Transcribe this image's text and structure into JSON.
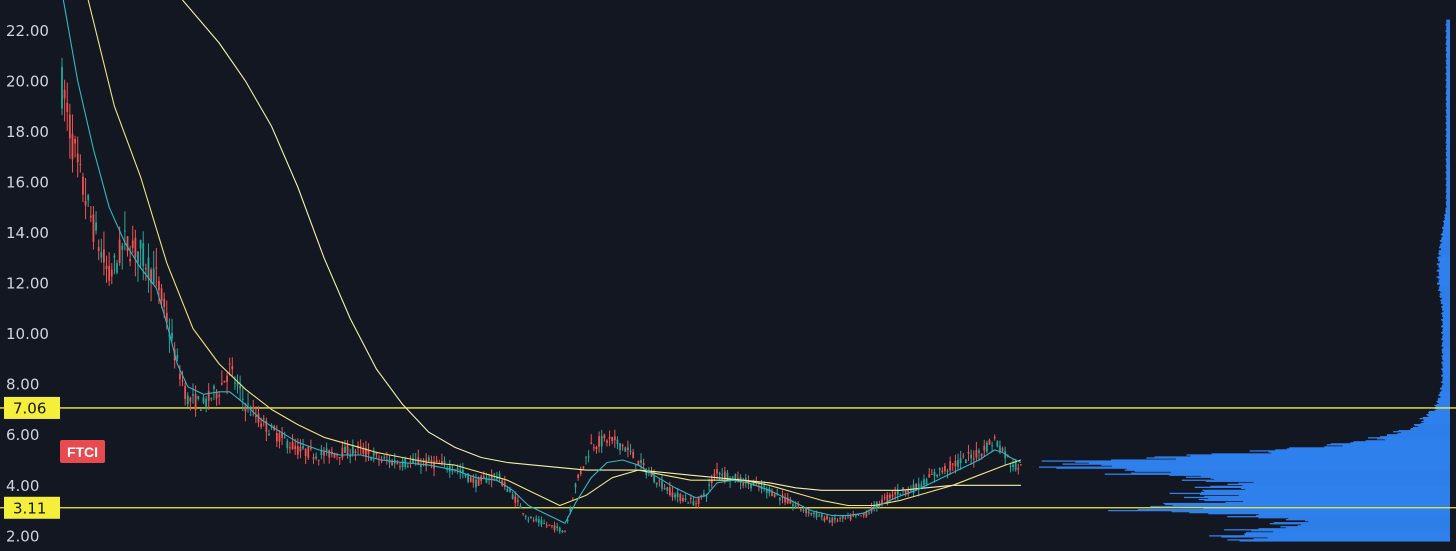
{
  "chart_data": {
    "type": "candlestick",
    "ticker": "FTCI",
    "ylim": [
      1.4,
      23.2
    ],
    "y_ticks": [
      "22.00",
      "20.00",
      "18.00",
      "16.00",
      "14.00",
      "12.00",
      "10.00",
      "8.00",
      "6.00",
      "4.00",
      "2.00"
    ],
    "levels": [
      {
        "value": 7.06,
        "label": "7.06"
      },
      {
        "value": 3.11,
        "label": "3.11"
      }
    ],
    "price_path": [
      [
        0,
        19.8
      ],
      [
        6,
        16.5
      ],
      [
        12,
        14.2
      ],
      [
        18,
        12.2
      ],
      [
        24,
        13.6
      ],
      [
        30,
        13.2
      ],
      [
        36,
        12.2
      ],
      [
        40,
        10.6
      ],
      [
        44,
        8.8
      ],
      [
        48,
        7.4
      ],
      [
        54,
        7.2
      ],
      [
        60,
        7.8
      ],
      [
        64,
        8.6
      ],
      [
        70,
        7.2
      ],
      [
        76,
        6.5
      ],
      [
        82,
        6.0
      ],
      [
        90,
        5.4
      ],
      [
        98,
        5.2
      ],
      [
        106,
        5.3
      ],
      [
        114,
        5.4
      ],
      [
        122,
        5.0
      ],
      [
        130,
        4.9
      ],
      [
        140,
        4.9
      ],
      [
        150,
        4.7
      ],
      [
        158,
        4.1
      ],
      [
        166,
        4.4
      ],
      [
        172,
        3.6
      ],
      [
        178,
        2.7
      ],
      [
        186,
        2.4
      ],
      [
        192,
        2.2
      ],
      [
        196,
        4.0
      ],
      [
        202,
        5.6
      ],
      [
        208,
        5.8
      ],
      [
        214,
        5.6
      ],
      [
        220,
        4.9
      ],
      [
        226,
        4.3
      ],
      [
        234,
        3.6
      ],
      [
        242,
        3.3
      ],
      [
        246,
        3.7
      ],
      [
        250,
        4.6
      ],
      [
        256,
        4.3
      ],
      [
        262,
        4.1
      ],
      [
        270,
        3.8
      ],
      [
        278,
        3.3
      ],
      [
        286,
        2.9
      ],
      [
        294,
        2.6
      ],
      [
        300,
        2.7
      ],
      [
        306,
        2.8
      ],
      [
        312,
        3.3
      ],
      [
        318,
        3.7
      ],
      [
        326,
        3.9
      ],
      [
        334,
        4.5
      ],
      [
        342,
        4.9
      ],
      [
        350,
        5.3
      ],
      [
        356,
        5.8
      ],
      [
        359,
        5.4
      ],
      [
        362,
        4.9
      ],
      [
        366,
        4.7
      ]
    ],
    "ema_fast": [
      [
        0,
        23.5
      ],
      [
        6,
        20.0
      ],
      [
        12,
        17.3
      ],
      [
        18,
        15.0
      ],
      [
        24,
        13.6
      ],
      [
        30,
        12.6
      ],
      [
        36,
        11.8
      ],
      [
        40,
        10.4
      ],
      [
        44,
        8.8
      ],
      [
        48,
        7.9
      ],
      [
        54,
        7.6
      ],
      [
        60,
        7.7
      ],
      [
        64,
        7.7
      ],
      [
        70,
        7.2
      ],
      [
        76,
        6.6
      ],
      [
        82,
        6.2
      ],
      [
        90,
        5.7
      ],
      [
        98,
        5.4
      ],
      [
        106,
        5.2
      ],
      [
        114,
        5.2
      ],
      [
        122,
        5.0
      ],
      [
        130,
        4.9
      ],
      [
        140,
        4.8
      ],
      [
        150,
        4.6
      ],
      [
        158,
        4.3
      ],
      [
        166,
        4.2
      ],
      [
        172,
        3.8
      ],
      [
        178,
        3.2
      ],
      [
        186,
        2.8
      ],
      [
        192,
        2.5
      ],
      [
        196,
        3.3
      ],
      [
        202,
        4.3
      ],
      [
        208,
        4.9
      ],
      [
        214,
        5.0
      ],
      [
        220,
        4.8
      ],
      [
        226,
        4.4
      ],
      [
        234,
        3.9
      ],
      [
        242,
        3.5
      ],
      [
        246,
        3.6
      ],
      [
        250,
        4.1
      ],
      [
        256,
        4.2
      ],
      [
        262,
        4.1
      ],
      [
        270,
        3.8
      ],
      [
        278,
        3.4
      ],
      [
        286,
        3.0
      ],
      [
        294,
        2.8
      ],
      [
        300,
        2.8
      ],
      [
        306,
        2.9
      ],
      [
        312,
        3.2
      ],
      [
        318,
        3.5
      ],
      [
        326,
        3.8
      ],
      [
        334,
        4.2
      ],
      [
        342,
        4.6
      ],
      [
        350,
        5.0
      ],
      [
        356,
        5.4
      ],
      [
        359,
        5.3
      ],
      [
        362,
        5.1
      ],
      [
        366,
        4.9
      ]
    ],
    "ema_slow": [
      [
        10,
        23.2
      ],
      [
        20,
        19.0
      ],
      [
        30,
        16.2
      ],
      [
        40,
        12.8
      ],
      [
        50,
        10.2
      ],
      [
        60,
        8.8
      ],
      [
        70,
        7.8
      ],
      [
        80,
        7.0
      ],
      [
        90,
        6.4
      ],
      [
        100,
        5.9
      ],
      [
        110,
        5.6
      ],
      [
        120,
        5.3
      ],
      [
        130,
        5.1
      ],
      [
        140,
        4.9
      ],
      [
        150,
        4.8
      ],
      [
        160,
        4.5
      ],
      [
        170,
        4.2
      ],
      [
        180,
        3.7
      ],
      [
        190,
        3.2
      ],
      [
        200,
        3.6
      ],
      [
        210,
        4.3
      ],
      [
        220,
        4.6
      ],
      [
        230,
        4.4
      ],
      [
        240,
        4.2
      ],
      [
        250,
        4.2
      ],
      [
        260,
        4.2
      ],
      [
        270,
        4.0
      ],
      [
        280,
        3.7
      ],
      [
        290,
        3.4
      ],
      [
        300,
        3.2
      ],
      [
        310,
        3.2
      ],
      [
        320,
        3.4
      ],
      [
        330,
        3.7
      ],
      [
        340,
        4.0
      ],
      [
        350,
        4.4
      ],
      [
        360,
        4.8
      ],
      [
        366,
        5.0
      ]
    ],
    "sma_200": [
      [
        46,
        23.2
      ],
      [
        60,
        21.5
      ],
      [
        70,
        20.0
      ],
      [
        80,
        18.2
      ],
      [
        90,
        15.8
      ],
      [
        100,
        13.0
      ],
      [
        110,
        10.6
      ],
      [
        120,
        8.6
      ],
      [
        130,
        7.2
      ],
      [
        140,
        6.1
      ],
      [
        150,
        5.5
      ],
      [
        160,
        5.1
      ],
      [
        170,
        4.9
      ],
      [
        180,
        4.8
      ],
      [
        190,
        4.7
      ],
      [
        200,
        4.6
      ],
      [
        210,
        4.6
      ],
      [
        220,
        4.6
      ],
      [
        230,
        4.5
      ],
      [
        240,
        4.4
      ],
      [
        250,
        4.3
      ],
      [
        260,
        4.2
      ],
      [
        270,
        4.1
      ],
      [
        280,
        3.9
      ],
      [
        290,
        3.8
      ],
      [
        300,
        3.8
      ],
      [
        310,
        3.8
      ],
      [
        320,
        3.8
      ],
      [
        330,
        3.9
      ],
      [
        340,
        4.0
      ],
      [
        350,
        4.0
      ],
      [
        360,
        4.0
      ],
      [
        366,
        4.0
      ]
    ],
    "volume_profile": [
      [
        2.0,
        0.55
      ],
      [
        2.2,
        0.52
      ],
      [
        2.4,
        0.42
      ],
      [
        2.6,
        0.4
      ],
      [
        2.8,
        0.52
      ],
      [
        3.0,
        0.78
      ],
      [
        3.2,
        0.72
      ],
      [
        3.4,
        0.6
      ],
      [
        3.6,
        0.66
      ],
      [
        3.8,
        0.62
      ],
      [
        4.0,
        0.56
      ],
      [
        4.2,
        0.6
      ],
      [
        4.4,
        0.74
      ],
      [
        4.6,
        0.86
      ],
      [
        4.8,
        1.0
      ],
      [
        5.0,
        0.9
      ],
      [
        5.2,
        0.62
      ],
      [
        5.4,
        0.44
      ],
      [
        5.6,
        0.3
      ],
      [
        5.8,
        0.2
      ],
      [
        6.0,
        0.16
      ],
      [
        6.2,
        0.11
      ],
      [
        6.4,
        0.08
      ],
      [
        6.6,
        0.07
      ],
      [
        6.8,
        0.06
      ],
      [
        7.0,
        0.04
      ],
      [
        7.4,
        0.03
      ],
      [
        8.0,
        0.02
      ],
      [
        9.0,
        0.02
      ],
      [
        10.0,
        0.02
      ],
      [
        11.0,
        0.02
      ],
      [
        12.0,
        0.03
      ],
      [
        13.0,
        0.03
      ],
      [
        14.0,
        0.02
      ],
      [
        15.0,
        0.01
      ],
      [
        16.0,
        0.01
      ],
      [
        18.0,
        0.01
      ],
      [
        20.0,
        0.01
      ],
      [
        22.0,
        0.01
      ]
    ],
    "colors": {
      "background": "#131722",
      "axis_text": "#d1d4dc",
      "up": "#26a69a",
      "down": "#ef5350",
      "ema_fast": "#2fb8c4",
      "ema_slow": "#f2e37b",
      "sma_200": "#f7f0a8",
      "level": "#f5ee3a",
      "level_label_bg": "#f5ee3a",
      "volume_profile": "#2f80ed",
      "ticker_bg": "#e84a4f"
    }
  }
}
